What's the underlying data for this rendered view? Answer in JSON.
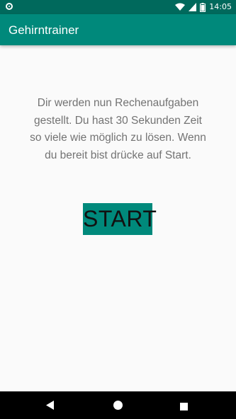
{
  "status_bar": {
    "time": "14:05",
    "icons": [
      "notification-icon",
      "wifi-icon",
      "signal-icon",
      "battery-icon"
    ]
  },
  "app_bar": {
    "title": "Gehirntrainer",
    "color": "#00897b"
  },
  "main": {
    "instructions": "Dir werden nun Rechenaufgaben gestellt. Du hast 30 Sekunden Zeit so viele wie möglich zu lösen. Wenn du bereit bist drücke auf Start.",
    "start_label": "START"
  },
  "nav_bar": {
    "icons": [
      "back-icon",
      "home-icon",
      "recent-apps-icon"
    ]
  },
  "colors": {
    "status_bar": "#00695c",
    "accent": "#00897b",
    "background": "#fafafa"
  }
}
